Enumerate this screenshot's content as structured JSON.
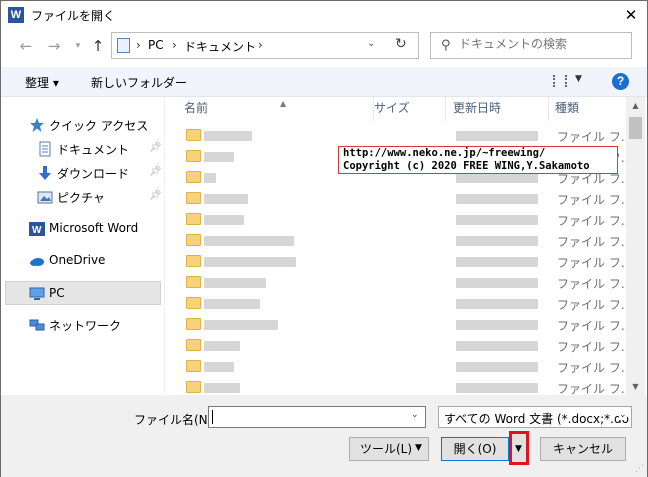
{
  "title": "ファイルを開く",
  "app_icon": "W",
  "address": {
    "segments": [
      "PC",
      "ドキュメント"
    ]
  },
  "search": {
    "placeholder": "ドキュメントの検索"
  },
  "toolbar": {
    "organize": "整理 ▾",
    "new_folder": "新しいフォルダー",
    "help": "?"
  },
  "sidebar": {
    "items": [
      {
        "label": "クイック アクセス",
        "icon": "star-icon"
      },
      {
        "label": "ドキュメント",
        "icon": "document-icon"
      },
      {
        "label": "ダウンロード",
        "icon": "download-icon"
      },
      {
        "label": "ピクチャ",
        "icon": "pictures-icon"
      },
      {
        "label": "Microsoft Word",
        "icon": "word-icon"
      },
      {
        "label": "OneDrive",
        "icon": "cloud-icon"
      },
      {
        "label": "PC",
        "icon": "computer-icon"
      },
      {
        "label": "ネットワーク",
        "icon": "network-icon"
      }
    ]
  },
  "columns": [
    "名前",
    "サイズ",
    "更新日時",
    "種類"
  ],
  "file_type": "ファイル フ...",
  "note": {
    "line1": "http://www.neko.ne.jp/~freewing/",
    "line2": "Copyright (c) 2020 FREE WING,Y.Sakamoto"
  },
  "bottom": {
    "filename_label": "ファイル名(N):",
    "filename_value": "",
    "filter": "すべての Word 文書 (*.docx;*.do",
    "tools": "ツール(L)",
    "open": "開く(O)",
    "cancel": "キャンセル"
  },
  "colors": {
    "accent": "#0078d7",
    "highlight": "#e0141e",
    "folder": "#f6d27a"
  }
}
